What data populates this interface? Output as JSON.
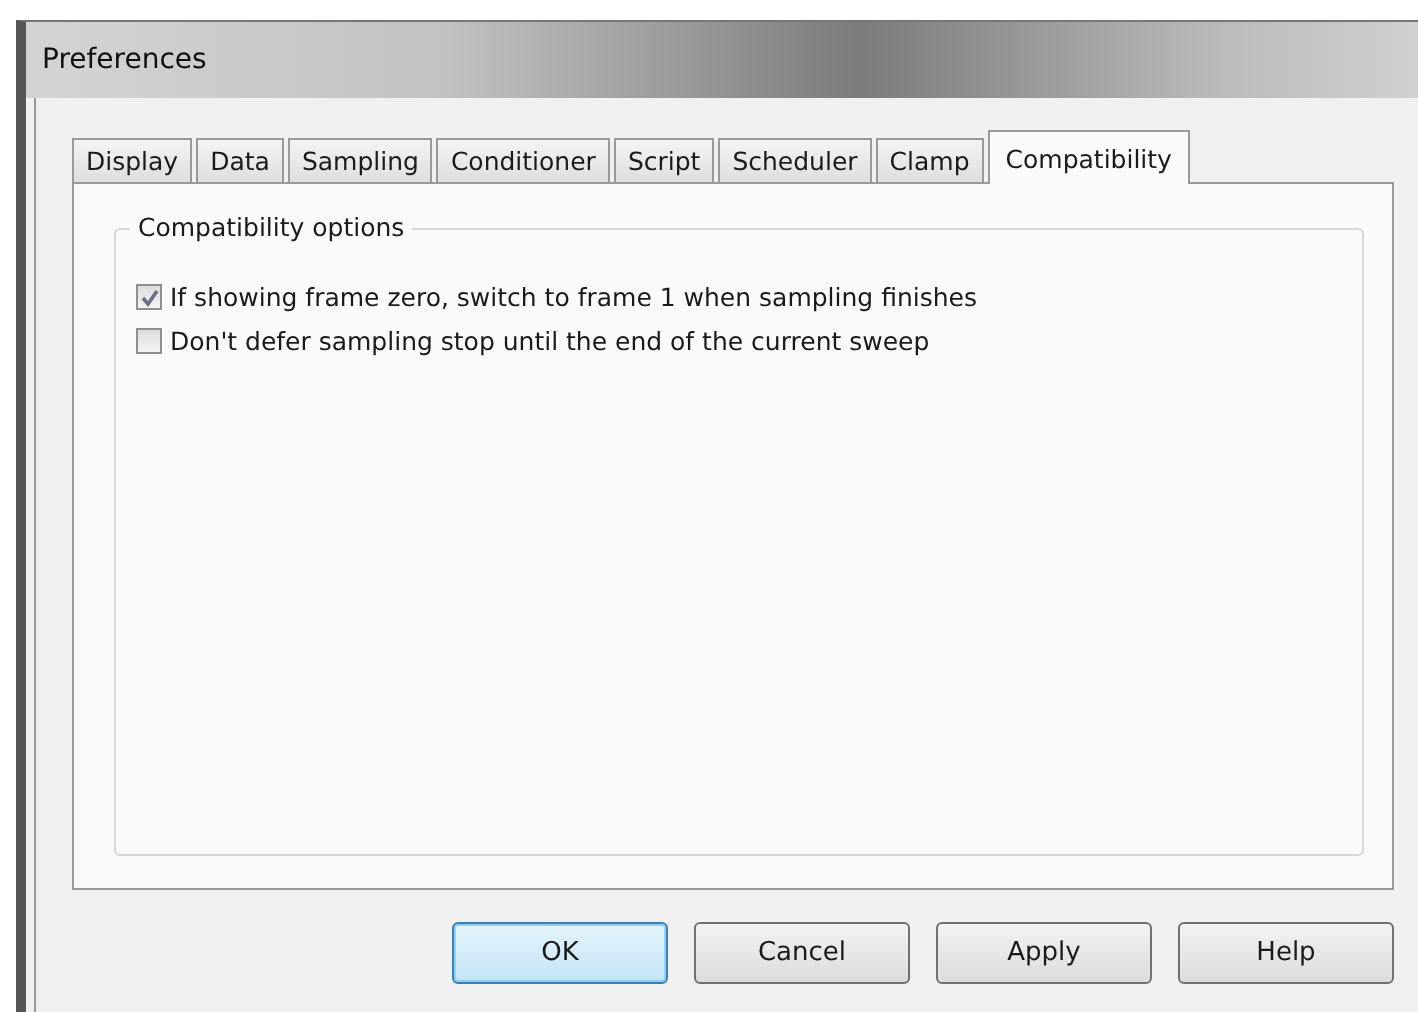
{
  "window": {
    "title": "Preferences"
  },
  "tabs": [
    {
      "label": "Display",
      "selected": false
    },
    {
      "label": "Data",
      "selected": false
    },
    {
      "label": "Sampling",
      "selected": false
    },
    {
      "label": "Conditioner",
      "selected": false
    },
    {
      "label": "Script",
      "selected": false
    },
    {
      "label": "Scheduler",
      "selected": false
    },
    {
      "label": "Clamp",
      "selected": false
    },
    {
      "label": "Compatibility",
      "selected": true
    }
  ],
  "group": {
    "title": "Compatibility options",
    "options": [
      {
        "label": "If showing frame zero, switch to frame 1 when sampling finishes",
        "checked": true
      },
      {
        "label": "Don't defer sampling stop until the end of the current sweep",
        "checked": false
      }
    ]
  },
  "buttons": [
    {
      "label": "OK",
      "default": true
    },
    {
      "label": "Cancel",
      "default": false
    },
    {
      "label": "Apply",
      "default": false
    },
    {
      "label": "Help",
      "default": false
    }
  ]
}
